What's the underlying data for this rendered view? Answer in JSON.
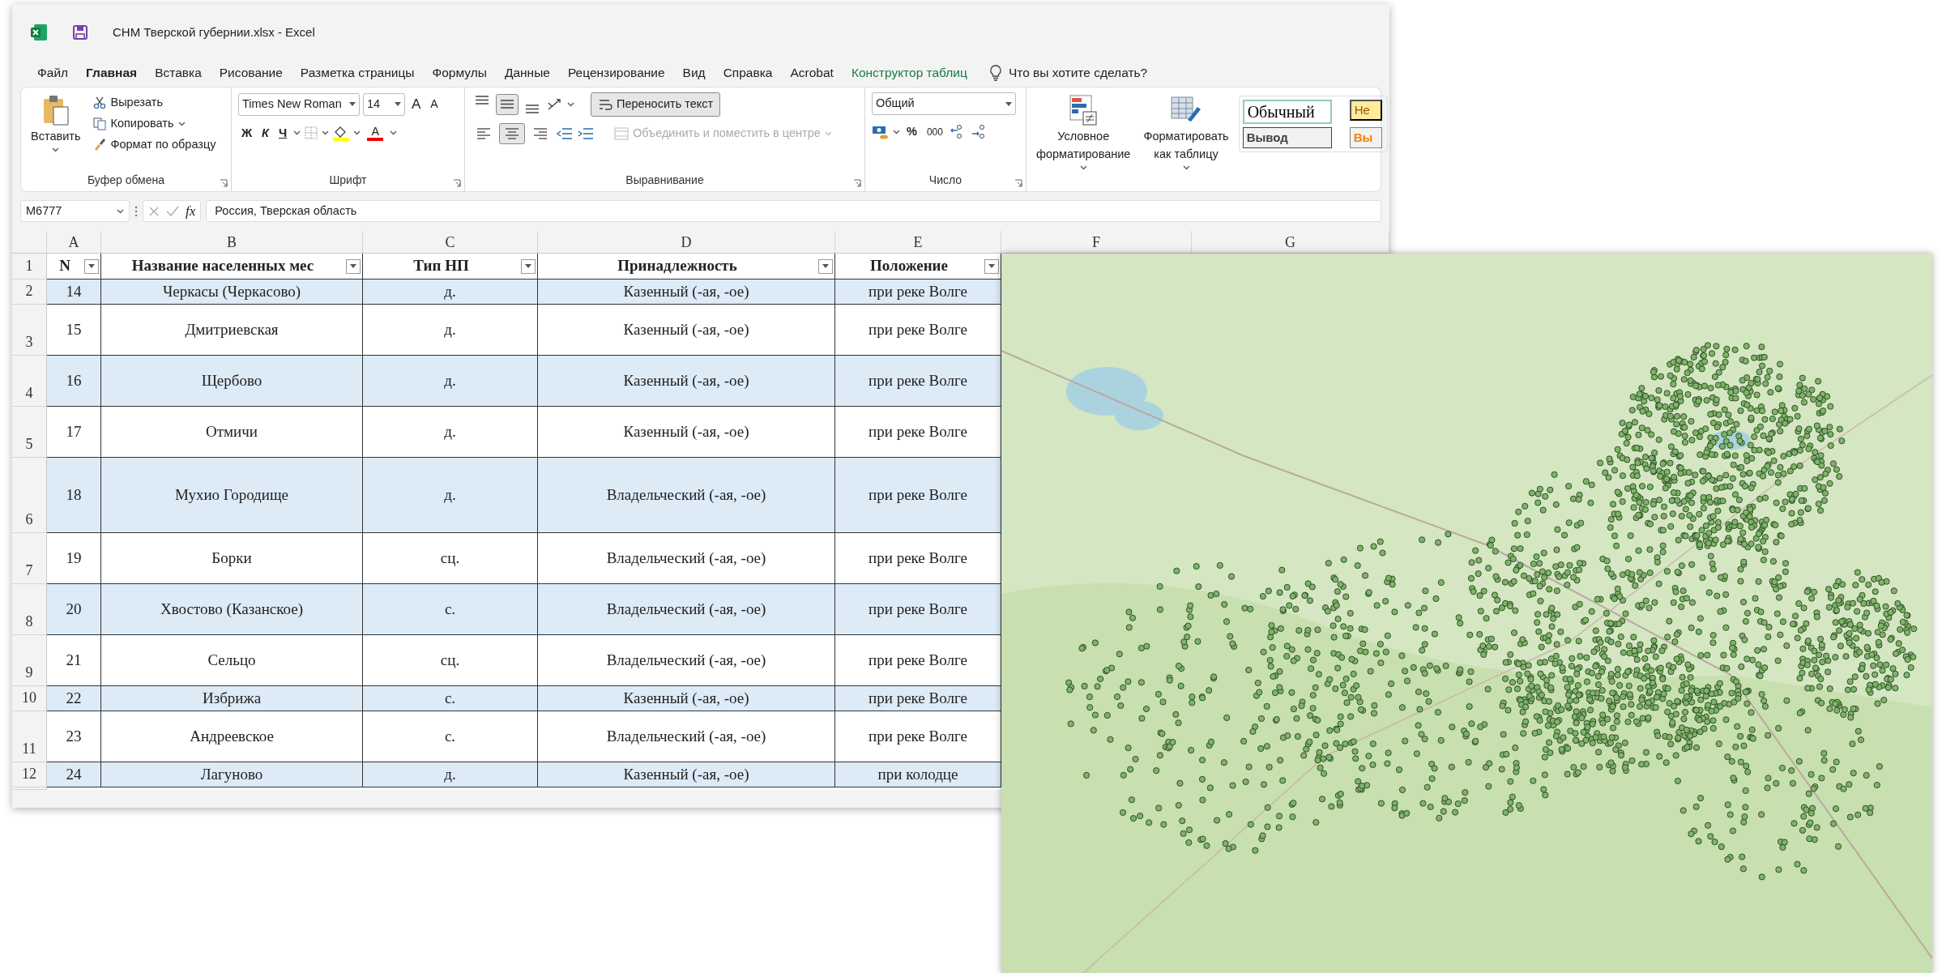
{
  "window": {
    "title": "СНМ Тверской губернии.xlsx  -  Excel"
  },
  "menu_tabs": [
    {
      "label": "Файл",
      "selected": false,
      "kind": "normal"
    },
    {
      "label": "Главная",
      "selected": true,
      "kind": "normal"
    },
    {
      "label": "Вставка",
      "selected": false,
      "kind": "normal"
    },
    {
      "label": "Рисование",
      "selected": false,
      "kind": "normal"
    },
    {
      "label": "Разметка страницы",
      "selected": false,
      "kind": "normal"
    },
    {
      "label": "Формулы",
      "selected": false,
      "kind": "normal"
    },
    {
      "label": "Данные",
      "selected": false,
      "kind": "normal"
    },
    {
      "label": "Рецензирование",
      "selected": false,
      "kind": "normal"
    },
    {
      "label": "Вид",
      "selected": false,
      "kind": "normal"
    },
    {
      "label": "Справка",
      "selected": false,
      "kind": "normal"
    },
    {
      "label": "Acrobat",
      "selected": false,
      "kind": "normal"
    },
    {
      "label": "Конструктор таблиц",
      "selected": false,
      "kind": "contextual"
    }
  ],
  "tell_me": "Что вы хотите сделать?",
  "ribbon": {
    "clipboard": {
      "label": "Буфер обмена",
      "paste": "Вставить",
      "cut": "Вырезать",
      "copy": "Копировать",
      "format_painter": "Формат по образцу"
    },
    "font": {
      "label": "Шрифт",
      "font_name": "Times New Roman",
      "font_size": "14",
      "grow": "A",
      "shrink": "A",
      "bold": "Ж",
      "italic": "К",
      "underline": "Ч",
      "font_color": "A"
    },
    "alignment": {
      "label": "Выравнивание",
      "vertical_buttons": [
        {
          "selected": false
        },
        {
          "selected": true
        },
        {
          "selected": false
        }
      ],
      "horizontal_buttons": [
        {
          "selected": false
        },
        {
          "selected": true
        },
        {
          "selected": false
        }
      ],
      "wrap_text": "Переносить текст",
      "merge": {
        "label": "Объединить и поместить в центре",
        "disabled": true
      }
    },
    "number": {
      "label": "Число",
      "format": "Общий",
      "percent": "%",
      "thousands": "000"
    },
    "styles": {
      "conditional": "Условное форматирование",
      "format_table": "Форматировать как таблицу",
      "cells": [
        {
          "label": "Обычный",
          "kind": "normal"
        },
        {
          "label": "Не",
          "kind": "bad"
        },
        {
          "label": "Вывод",
          "kind": "output"
        },
        {
          "label": "Вы",
          "kind": "calc"
        }
      ]
    }
  },
  "formula_bar": {
    "name_box": "M6777",
    "function_label": "fx",
    "formula": "Россия, Тверская область"
  },
  "sheet": {
    "columns": [
      "A",
      "B",
      "C",
      "D",
      "E",
      "F",
      "G"
    ],
    "header": {
      "row_number": "1",
      "cells": [
        "N",
        "Название населенных мес",
        "Тип НП",
        "Принадлежность",
        "Положение"
      ]
    },
    "rows": [
      {
        "row_number": "2",
        "cells": [
          "14",
          "Черкасы (Черкасово)",
          "д.",
          "Казенный (-ая, -ое)",
          "при реке Волге"
        ]
      },
      {
        "row_number": "3",
        "cells": [
          "15",
          "Дмитриевская",
          "д.",
          "Казенный (-ая, -ое)",
          "при реке Волге"
        ]
      },
      {
        "row_number": "4",
        "cells": [
          "16",
          "Щербово",
          "д.",
          "Казенный (-ая, -ое)",
          "при реке Волге"
        ]
      },
      {
        "row_number": "5",
        "cells": [
          "17",
          "Отмичи",
          "д.",
          "Казенный (-ая, -ое)",
          "при реке Волге"
        ]
      },
      {
        "row_number": "6",
        "cells": [
          "18",
          "Мухио Городище",
          "д.",
          "Владельческий (-ая, -ое)",
          "при реке Волге"
        ]
      },
      {
        "row_number": "7",
        "cells": [
          "19",
          "Борки",
          "сц.",
          "Владельческий (-ая, -ое)",
          "при реке Волге"
        ]
      },
      {
        "row_number": "8",
        "cells": [
          "20",
          "Хвостово (Казанское)",
          "с.",
          "Владельческий (-ая, -ое)",
          "при реке Волге"
        ]
      },
      {
        "row_number": "9",
        "cells": [
          "21",
          "Сельцо",
          "сц.",
          "Владельческий (-ая, -ое)",
          "при реке Волге"
        ]
      },
      {
        "row_number": "10",
        "cells": [
          "22",
          "Избрижа",
          "с.",
          "Казенный (-ая, -ое)",
          "при реке Волге"
        ]
      },
      {
        "row_number": "11",
        "cells": [
          "23",
          "Андреевское",
          "с.",
          "Владельческий (-ая, -ое)",
          "при реке Волге"
        ]
      },
      {
        "row_number": "12",
        "cells": [
          "24",
          "Лагуново",
          "д.",
          "Казенный (-ая, -ое)",
          "при колодце"
        ]
      }
    ]
  }
}
